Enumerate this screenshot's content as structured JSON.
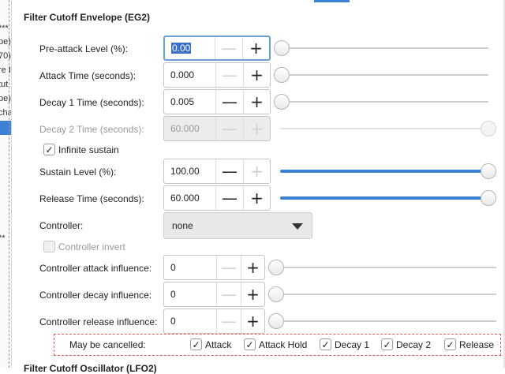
{
  "left_strip": {
    "fragments": [
      "***",
      "pe)",
      "70)",
      "re I",
      "tut",
      "pe)",
      "cha",
      "**"
    ]
  },
  "section": {
    "title": "Filter Cutoff Envelope (EG2)",
    "next_title": "Filter Cutoff Oscillator (LFO2)"
  },
  "rows": {
    "pre_attack": {
      "label": "Pre-attack Level (%):",
      "value": "0.00",
      "slider_fraction": 0.0
    },
    "attack": {
      "label": "Attack Time (seconds):",
      "value": "0.000",
      "slider_fraction": 0.0
    },
    "decay1": {
      "label": "Decay 1 Time (seconds):",
      "value": "0.005",
      "slider_fraction": 0.0
    },
    "decay2": {
      "label": "Decay 2 Time (seconds):",
      "value": "60.000",
      "slider_fraction": 1.0
    },
    "infinite_sustain": {
      "label": "Infinite sustain",
      "checked": true
    },
    "sustain": {
      "label": "Sustain Level (%):",
      "value": "100.00",
      "slider_fraction": 1.0
    },
    "release": {
      "label": "Release Time (seconds):",
      "value": "60.000",
      "slider_fraction": 1.0
    },
    "controller": {
      "label": "Controller:",
      "selected": "none"
    },
    "controller_invert": {
      "label": "Controller invert",
      "checked": false
    },
    "ctrl_attack": {
      "label": "Controller attack influence:",
      "value": "0",
      "slider_fraction": 0.0
    },
    "ctrl_decay": {
      "label": "Controller decay influence:",
      "value": "0",
      "slider_fraction": 0.0
    },
    "ctrl_release": {
      "label": "Controller release influence:",
      "value": "0",
      "slider_fraction": 0.0
    }
  },
  "glyphs": {
    "minus": "—",
    "plus": "+",
    "check": "✓"
  },
  "cancellable": {
    "title": "May be cancelled:",
    "options": [
      {
        "label": "Attack",
        "checked": true
      },
      {
        "label": "Attack Hold",
        "checked": true
      },
      {
        "label": "Decay 1",
        "checked": true
      },
      {
        "label": "Decay 2",
        "checked": true
      },
      {
        "label": "Release",
        "checked": true
      }
    ]
  },
  "colors": {
    "accent": "#3b82d6",
    "dashed_border": "#e05a5a",
    "selection": "#3b6fc9"
  }
}
